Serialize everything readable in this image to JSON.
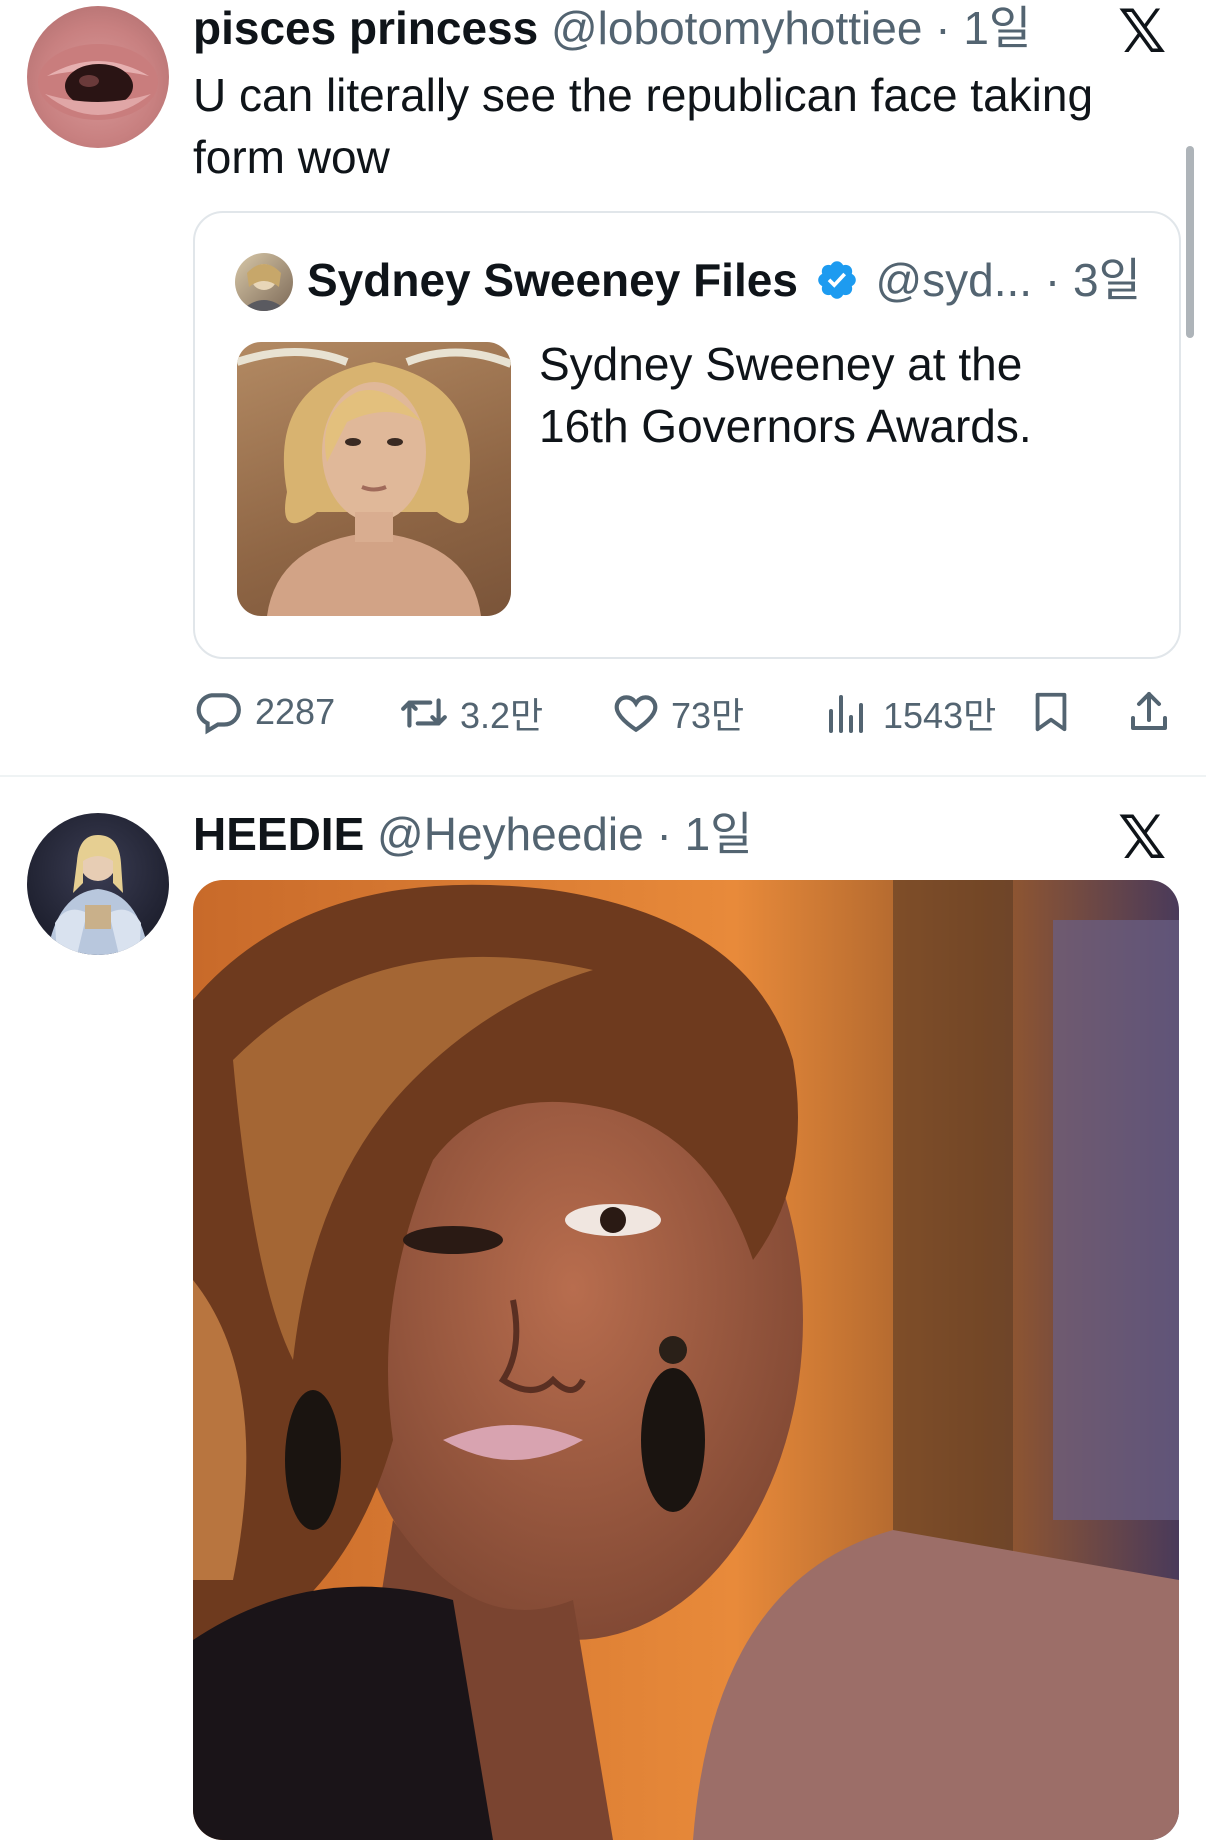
{
  "tweet1": {
    "display_name": "pisces princess",
    "handle": "@lobotomyhottiee",
    "sep": "·",
    "time": "1일",
    "text_line1": "U can literally see the republican face taking",
    "text_line2": "form wow",
    "quote": {
      "display_name": "Sydney Sweeney Files",
      "handle": "@syd...",
      "sep": "·",
      "time": "3일",
      "text_line1": "Sydney Sweeney at the",
      "text_line2": "16th Governors Awards."
    },
    "actions": {
      "replies": "2287",
      "reposts": "3.2만",
      "likes": "73만",
      "views": "1543만"
    }
  },
  "tweet2": {
    "display_name": "HEEDIE",
    "handle": "@Heyheedie",
    "sep": "·",
    "time": "1일"
  },
  "brand_logo": "𝕏",
  "colors": {
    "text": "#0f1419",
    "muted": "#536471",
    "verified": "#1d9bf0",
    "border": "#e1e6ea"
  }
}
